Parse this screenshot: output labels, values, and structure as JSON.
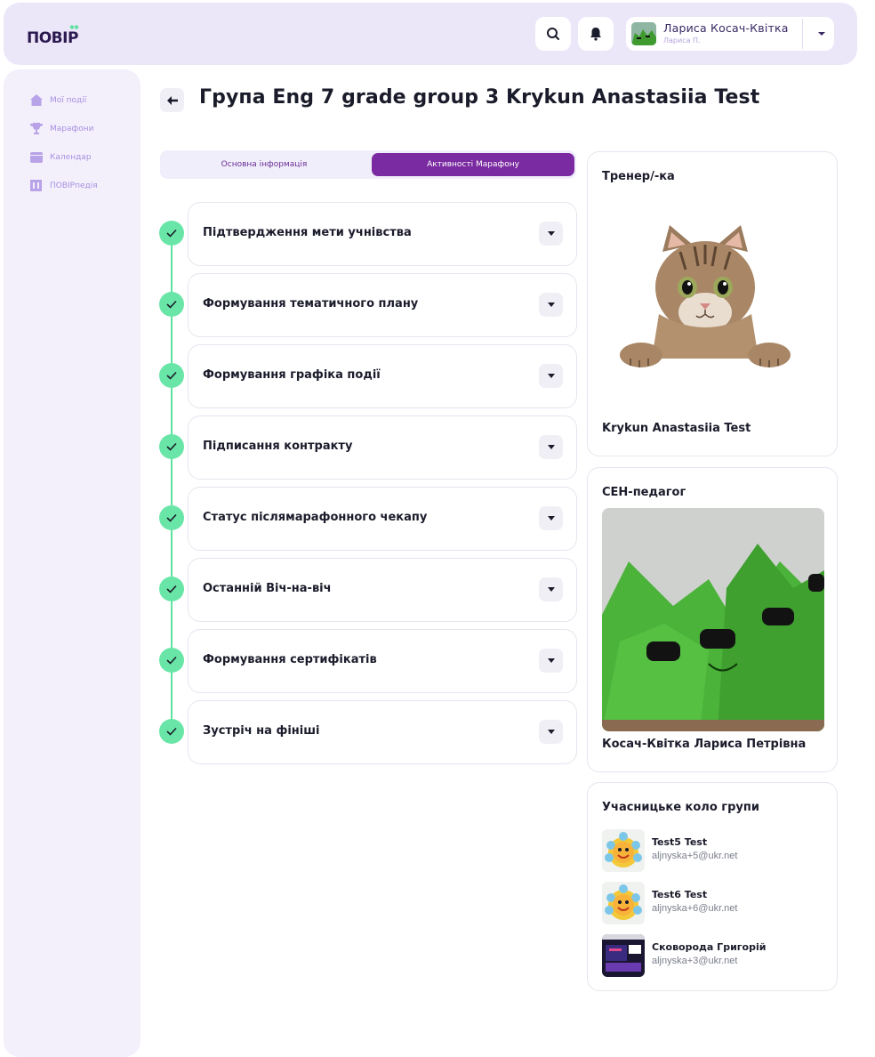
{
  "header": {
    "logo_text": "ПОВІР",
    "user": {
      "name": "Лариса Косач-Квітка",
      "subtitle": "Лариса П."
    }
  },
  "sidebar": {
    "items": [
      {
        "label": "Мої події",
        "icon": "home-icon"
      },
      {
        "label": "Марафони",
        "icon": "trophy-icon"
      },
      {
        "label": "Календар",
        "icon": "calendar-icon"
      },
      {
        "label": "ПОВІРпедія",
        "icon": "book-icon"
      }
    ]
  },
  "page": {
    "title": "Група Eng 7 grade group 3 Krykun Anastasiia Test"
  },
  "tabs": [
    {
      "label": "Основна інформація",
      "active": false
    },
    {
      "label": "Активності Марафону",
      "active": true
    }
  ],
  "activities": [
    {
      "label": "Підтвердження мети учнівства",
      "done": true
    },
    {
      "label": "Формування тематичного плану",
      "done": true
    },
    {
      "label": "Формування графіка події",
      "done": true
    },
    {
      "label": "Підписання контракту",
      "done": true
    },
    {
      "label": "Статус післямарафонного чекапу",
      "done": true
    },
    {
      "label": "Останній Віч-на-віч",
      "done": true
    },
    {
      "label": "Формування сертифікатів",
      "done": true
    },
    {
      "label": "Зустріч на фініші",
      "done": true
    }
  ],
  "trainer_card": {
    "title": "Тренер/-ка",
    "name": "Krykun Anastasiia Test"
  },
  "sen_card": {
    "title": "СЕН-педагог",
    "name": "Косач-Квітка Лариса Петрівна"
  },
  "members_card": {
    "title": "Учасницьке коло групи",
    "members": [
      {
        "name": "Test5 Test",
        "email": "aljnyska+5@ukr.net"
      },
      {
        "name": "Test6 Test",
        "email": "aljnyska+6@ukr.net"
      },
      {
        "name": "Сковорода Григорій",
        "email": "aljnyska+3@ukr.net"
      }
    ]
  },
  "colors": {
    "accent": "#7b2ba1",
    "header_bg": "#ece6f9",
    "sidebar_bg": "#f3f0fc",
    "success": "#69e6a7"
  }
}
